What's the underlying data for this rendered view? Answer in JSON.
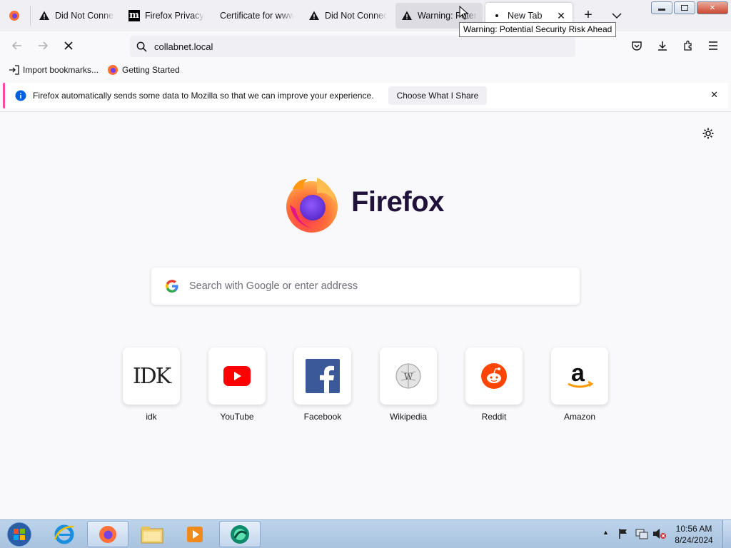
{
  "tabs": [
    {
      "label": "Did Not Connect: Potential Security Issue",
      "icon": "warning-icon"
    },
    {
      "label": "Firefox Privacy Notice",
      "icon": "mozilla-icon"
    },
    {
      "label": "Certificate for www",
      "icon": "none"
    },
    {
      "label": "Did Not Connect: Potential Security Issue",
      "icon": "warning-icon"
    },
    {
      "label": "Warning: Potential Security Risk Ahead",
      "icon": "warning-icon"
    },
    {
      "label": "New Tab",
      "icon": "loading-dot-icon"
    }
  ],
  "tooltip": "Warning: Potential Security Risk Ahead",
  "urlbar": {
    "value": "collabnet.local"
  },
  "bookmarks": [
    {
      "label": "Import bookmarks...",
      "icon": "import-icon"
    },
    {
      "label": "Getting Started",
      "icon": "firefox-icon"
    }
  ],
  "notification": {
    "text": "Firefox automatically sends some data to Mozilla so that we can improve your experience.",
    "button": "Choose What I Share"
  },
  "newtab": {
    "wordmark": "Firefox",
    "search_placeholder": "Search with Google or enter address",
    "shortcuts": [
      {
        "label": "idk",
        "logo": "IDK"
      },
      {
        "label": "YouTube",
        "logo": "youtube-icon"
      },
      {
        "label": "Facebook",
        "logo": "facebook-icon"
      },
      {
        "label": "Wikipedia",
        "logo": "wikipedia-icon"
      },
      {
        "label": "Reddit",
        "logo": "reddit-icon"
      },
      {
        "label": "Amazon",
        "logo": "amazon-icon"
      }
    ]
  },
  "taskbar": {
    "time": "10:56 AM",
    "date": "8/24/2024"
  },
  "colors": {
    "accent_pink": "#ff4aa2",
    "info_blue": "#0060df",
    "wordmark": "#20123a"
  }
}
